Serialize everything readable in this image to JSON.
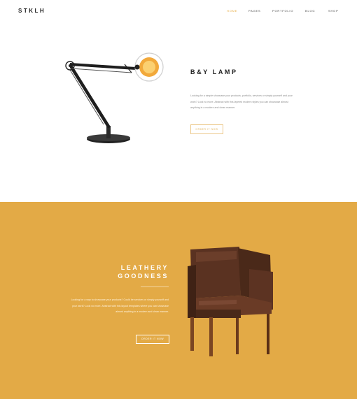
{
  "header": {
    "logo": "STKLH",
    "nav": [
      {
        "label": "Home",
        "active": true
      },
      {
        "label": "Pages"
      },
      {
        "label": "Portfolio"
      },
      {
        "label": "Blog"
      },
      {
        "label": "Shop"
      }
    ]
  },
  "lamp": {
    "title": "B&Y LAMP",
    "text": "Looking for a simple showcase your products, portfolio, services or simply yourself and your work? Look no more. Abstract with this layered modern styles you can showcase almost anything in a modern and clean manner.",
    "button": "Order it now",
    "image_icon": "desk-lamp-image"
  },
  "leather": {
    "title_line1": "LEATHERY",
    "title_line2": "GOODNESS",
    "text": "Looking for a way to showcase your products? Could be services or simply yourself and your work? Look no more. Abstract with this layout templates where you can showcase almost anything in a modern and clean manner.",
    "button": "Order it now",
    "image_icon": "leather-armchair-image"
  },
  "colors": {
    "accent": "#e3aa46",
    "white": "#ffffff",
    "dark": "#222222"
  }
}
